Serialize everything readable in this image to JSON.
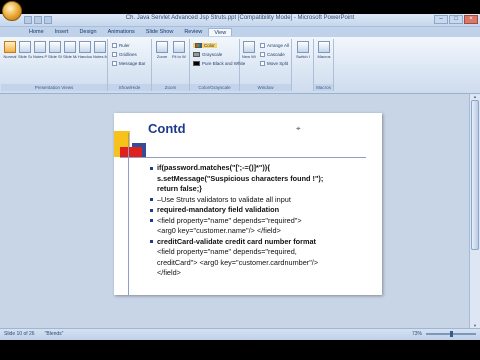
{
  "window": {
    "title": "Ch. Java Servlet Advanced Jsp Struts.ppt [Compatibility Mode] - Microsoft PowerPoint",
    "controls": [
      "–",
      "□",
      "×"
    ]
  },
  "tabs": [
    "Home",
    "Insert",
    "Design",
    "Animations",
    "Slide Show",
    "Review",
    "View"
  ],
  "active_tab": "View",
  "ribbon": {
    "groups": [
      {
        "label": "Presentation Views",
        "buttons": [
          "Normal",
          "Slide Sorter",
          "Notes Page",
          "Slide Show",
          "Slide Master",
          "Handout Master",
          "Notes Master"
        ]
      },
      {
        "label": "Show/Hide",
        "checks": [
          {
            "label": "Ruler",
            "checked": false
          },
          {
            "label": "Gridlines",
            "checked": false
          },
          {
            "label": "Message Bar",
            "checked": false
          }
        ]
      },
      {
        "label": "Zoom",
        "buttons": [
          "Zoom",
          "Fit to Window"
        ]
      },
      {
        "label": "Color/Grayscale",
        "items": [
          "Color",
          "Grayscale",
          "Pure Black and White"
        ]
      },
      {
        "label": "Window",
        "buttons": [
          "New Window"
        ],
        "items": [
          "Arrange All",
          "Cascade",
          "Move Split"
        ]
      },
      {
        "label": "",
        "buttons": [
          "Switch Windows"
        ]
      },
      {
        "label": "Macros",
        "buttons": [
          "Macros"
        ]
      }
    ]
  },
  "slide": {
    "title": "Contd",
    "bullets": [
      {
        "text": "if(password.matches(\"[';-=()]*\")){",
        "bold": true,
        "bullet": true
      },
      {
        "text": "s.setMessage(\"Suspicious characters found !\");",
        "bold": true,
        "bullet": false
      },
      {
        "text": "return false;}",
        "bold": true,
        "bullet": false
      },
      {
        "text": "–Use Struts validators to validate all input",
        "bold": false,
        "bullet": true
      },
      {
        "text": "required-mandatory field validation",
        "bold": true,
        "bullet": true
      },
      {
        "text": "<field property=\"name\" depends=\"required\">",
        "bold": false,
        "bullet": true
      },
      {
        "text": "<arg0 key=\"customer.name\"/> </field>",
        "bold": false,
        "bullet": false
      },
      {
        "text": "creditCard-validate credit card number format",
        "bold": true,
        "bullet": true
      },
      {
        "text": "<field property=\"name\" depends=\"required,",
        "bold": false,
        "bullet": false
      },
      {
        "text": "creditCard\"> <arg0 key=\"customer.cardnumber\"/>",
        "bold": false,
        "bullet": false
      },
      {
        "text": "</field>",
        "bold": false,
        "bullet": false
      }
    ]
  },
  "status": {
    "slide_info": "Slide 10 of 26",
    "theme": "\"Blends\"",
    "zoom": "73%"
  }
}
